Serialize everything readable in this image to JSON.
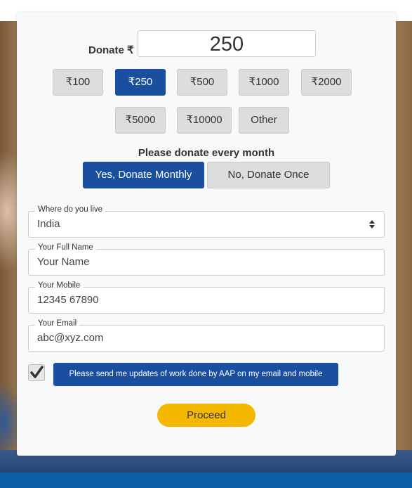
{
  "donation": {
    "label": "Donate ₹",
    "amount": "250"
  },
  "amount_options": [
    {
      "label": "₹100",
      "selected": false
    },
    {
      "label": "₹250",
      "selected": true
    },
    {
      "label": "₹500",
      "selected": false
    },
    {
      "label": "₹1000",
      "selected": false
    },
    {
      "label": "₹2000",
      "selected": false
    },
    {
      "label": "₹5000",
      "selected": false
    },
    {
      "label": "₹10000",
      "selected": false
    },
    {
      "label": "Other",
      "selected": false
    }
  ],
  "frequency": {
    "title": "Please donate every month",
    "monthly_label": "Yes, Donate Monthly",
    "once_label": "No, Donate Once",
    "selected": "monthly"
  },
  "form": {
    "location": {
      "legend": "Where do you live",
      "value": "India",
      "icon": "select-arrows-icon"
    },
    "name": {
      "legend": "Your Full Name",
      "value": "Your Name"
    },
    "mobile": {
      "legend": "Your Mobile",
      "value": "12345 67890"
    },
    "email": {
      "legend": "Your Email",
      "value": "abc@xyz.com"
    }
  },
  "updates": {
    "checked": true,
    "label": "Please send me updates of work done by AAP on my email and mobile"
  },
  "proceed_label": "Proceed",
  "colors": {
    "primary": "#1a4fa0",
    "button_inactive": "#dddddd",
    "proceed": "#f5b800",
    "footer_bar": "#0b5fa5"
  }
}
